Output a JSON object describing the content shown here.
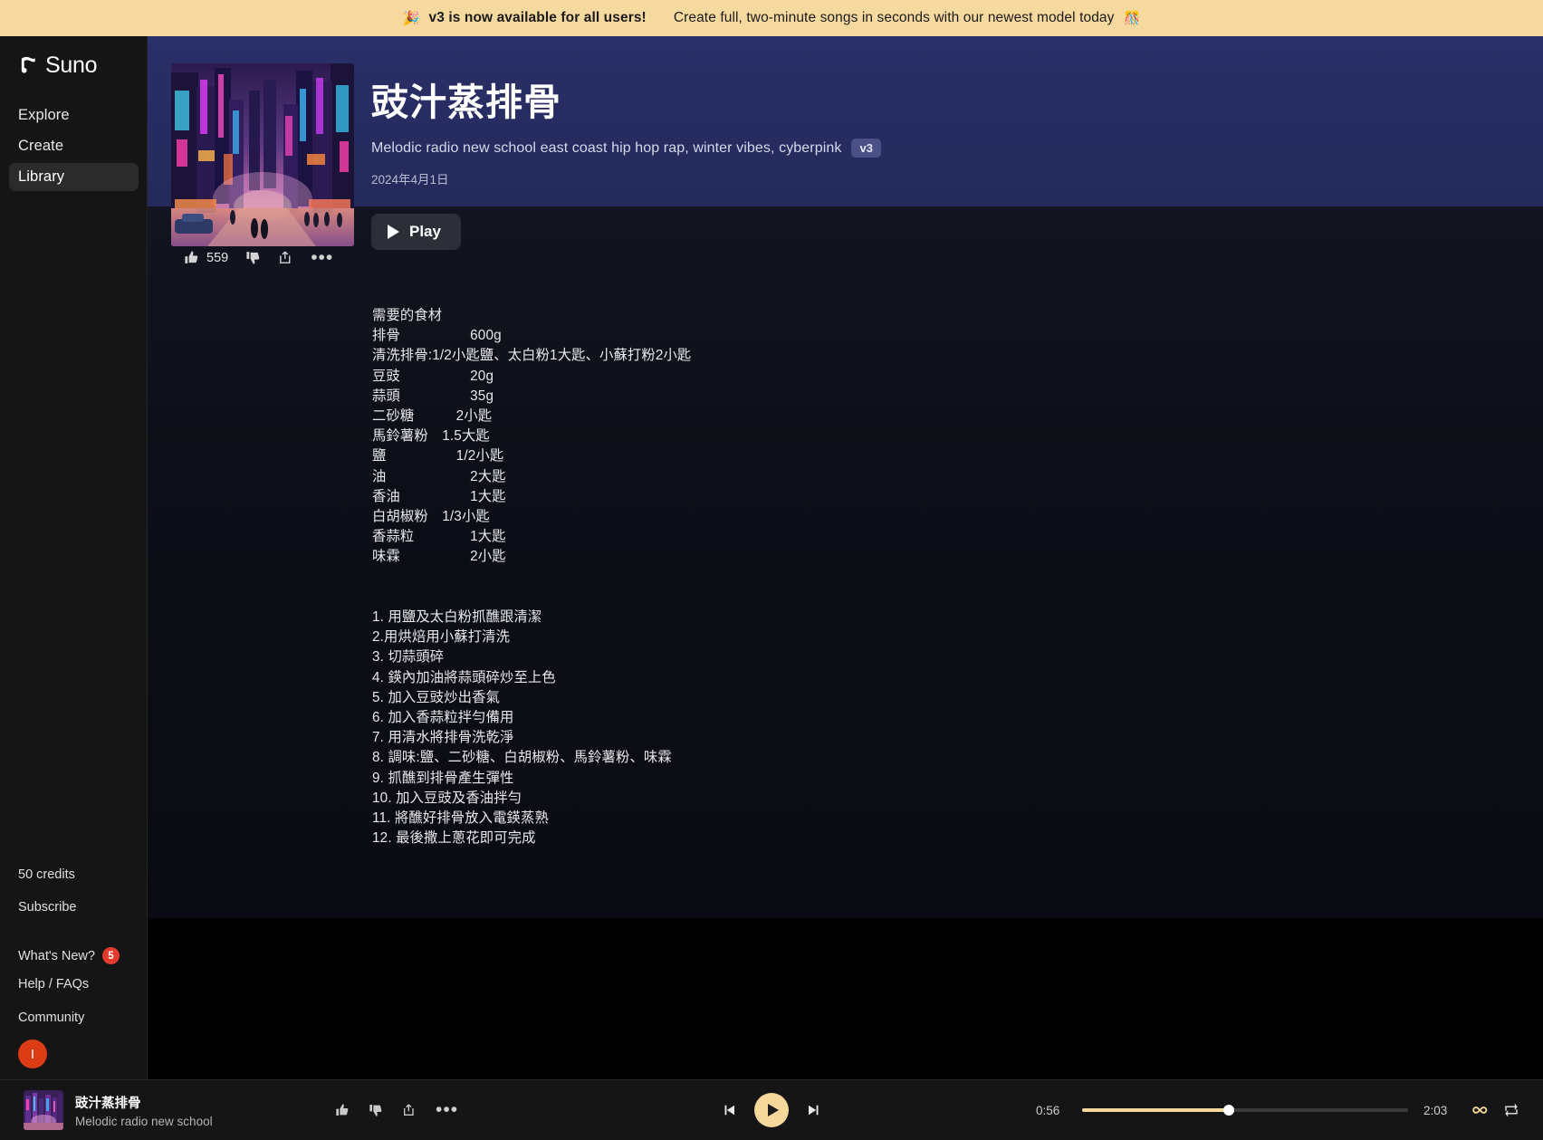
{
  "banner": {
    "emoji_left": "🎉",
    "headline": "v3 is now available for all users!",
    "subtext": "Create full, two-minute songs in seconds with our newest model today",
    "emoji_right": "🎊",
    "background_color": "#f6d99e"
  },
  "sidebar": {
    "brand": "Suno",
    "nav": [
      {
        "label": "Explore",
        "active": false
      },
      {
        "label": "Create",
        "active": false
      },
      {
        "label": "Library",
        "active": true
      }
    ],
    "credits": "50 credits",
    "subscribe": "Subscribe",
    "whats_new": "What's New?",
    "whats_new_count": "5",
    "help": "Help / FAQs",
    "community": "Community",
    "avatar_initial": "I",
    "avatar_color": "#dc3c13"
  },
  "hero": {
    "title": "豉汁蒸排骨",
    "style_tags": "Melodic radio new school east coast hip hop rap, winter vibes, cyberpink",
    "version_badge": "v3",
    "date": "2024年4月1日",
    "background_color": "#262c60"
  },
  "toolbar": {
    "play_label": "Play",
    "like_count": "559",
    "like_icon": "thumbs-up-icon",
    "dislike_icon": "thumbs-down-icon",
    "share_icon": "share-icon",
    "more_icon": "more-options-icon"
  },
  "lyrics": {
    "heading": "需要的食材",
    "text": "需要的食材\n排骨　　　　　600g\n清洗排骨:1/2小匙鹽、太白粉1大匙、小蘇打粉2小匙\n豆豉　　　　　20g\n蒜頭　　　　　35g\n二砂糖　　　2小匙\n馬鈴薯粉　1.5大匙\n鹽　　　　　1/2小匙\n油　　　　　　2大匙\n香油　　　　　1大匙\n白胡椒粉　1/3小匙\n香蒜粒　　　　1大匙\n味霖　　　　　2小匙\n\n\n1. 用鹽及太白粉抓醮跟清潔\n2.用烘焙用小蘇打清洗\n3. 切蒜頭碎\n4. 鍈內加油將蒜頭碎炒至上色\n5. 加入豆豉炒出香氣\n6. 加入香蒜粒拌勻備用\n7. 用清水將排骨洗乾淨\n8. 調味:鹽、二砂糖、白胡椒粉、馬鈴薯粉、味霖\n9. 抓醮到排骨產生彈性\n10. 加入豆豉及香油拌勻\n11. 將醮好排骨放入電鍈蒸熟\n12. 最後撒上蔥花即可完成",
    "ingredients": [
      {
        "name": "排骨",
        "amount": "600g"
      },
      {
        "name": "清洗排骨",
        "amount": "1/2小匙鹽、太白粉1大匙、小蘇打粉2小匙"
      },
      {
        "name": "豆豉",
        "amount": "20g"
      },
      {
        "name": "蒜頭",
        "amount": "35g"
      },
      {
        "name": "二砂糖",
        "amount": "2小匙"
      },
      {
        "name": "馬鈴薯粉",
        "amount": "1.5大匙"
      },
      {
        "name": "鹽",
        "amount": "1/2小匙"
      },
      {
        "name": "油",
        "amount": "2大匙"
      },
      {
        "name": "香油",
        "amount": "1大匙"
      },
      {
        "name": "白胡椒粉",
        "amount": "1/3小匙"
      },
      {
        "name": "香蒜粒",
        "amount": "1大匙"
      },
      {
        "name": "味霖",
        "amount": "2小匙"
      }
    ],
    "steps": [
      "1. 用鹽及太白粉抓醮跟清潔",
      "2.用烘焙用小蘇打清洗",
      "3. 切蒜頭碎",
      "4. 鍈內加油將蒜頭碎炒至上色",
      "5. 加入豆豉炒出香氣",
      "6. 加入香蒜粒拌勻備用",
      "7. 用清水將排骨洗乾淨",
      "8. 調味:鹽、二砂糖、白胡椒粉、馬鈴薯粉、味霖",
      "9. 抓醮到排骨產生彈性",
      "10. 加入豆豉及香油拌勻",
      "11. 將醮好排骨放入電鍈蒸熟",
      "12. 最後撒上蔥花即可完成"
    ]
  },
  "player": {
    "track_title": "豉汁蒸排骨",
    "track_artist": "Melodic radio new school",
    "current_time": "0:56",
    "total_time": "2:03",
    "progress_percent": 45,
    "accent_color": "#f6d89c",
    "prev_icon": "skip-previous-icon",
    "play_icon": "play-icon",
    "next_icon": "skip-next-icon",
    "infinity_icon": "infinity-icon",
    "repeat_icon": "repeat-icon"
  }
}
